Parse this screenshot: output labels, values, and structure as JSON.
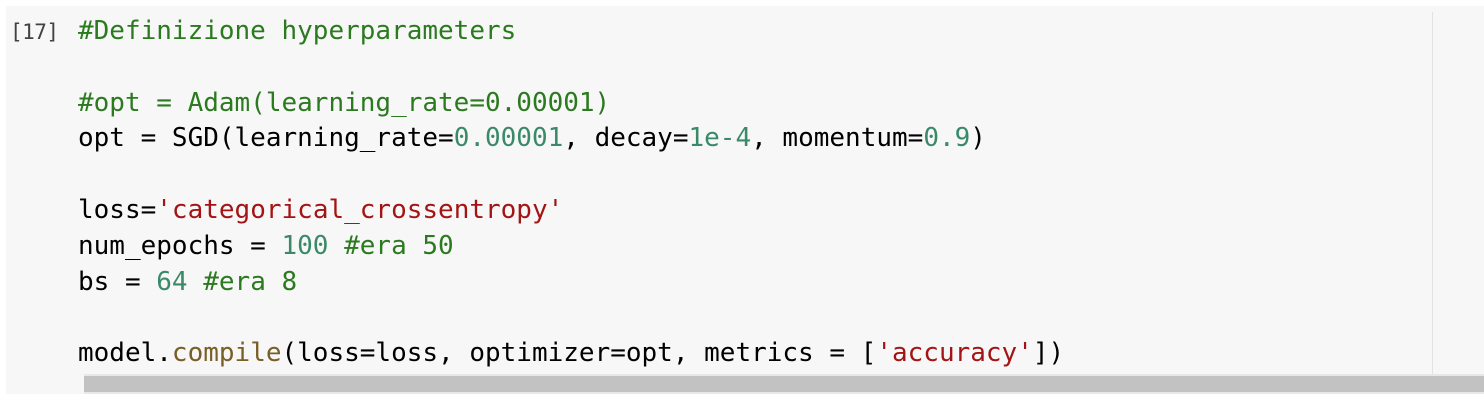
{
  "cell": {
    "execution_count": "[17]",
    "lines": {
      "l1_comment": "#Definizione hyperparameters",
      "l3_comment": "#opt = Adam(learning_rate=0.00001)",
      "l4_a": "opt = SGD(learning_rate=",
      "l4_num1": "0.00001",
      "l4_b": ", decay=",
      "l4_num2": "1e-4",
      "l4_c": ", momentum=",
      "l4_num3": "0.9",
      "l4_d": ")",
      "l6_a": "loss=",
      "l6_str": "'categorical_crossentropy'",
      "l7_a": "num_epochs = ",
      "l7_num": "100",
      "l7_comment": " #era 50",
      "l8_a": "bs = ",
      "l8_num": "64",
      "l8_comment": " #era 8",
      "l10_a": "model.",
      "l10_fn": "compile",
      "l10_b": "(loss=loss, optimizer=opt, metrics = [",
      "l10_str": "'accuracy'",
      "l10_c": "])"
    }
  },
  "colors": {
    "comment": "#2b7a1f",
    "number": "#3a8a6a",
    "string": "#a31515",
    "function": "#795e26",
    "cell_background": "#f7f7f7"
  },
  "scrollbar": {
    "orientation": "horizontal"
  }
}
